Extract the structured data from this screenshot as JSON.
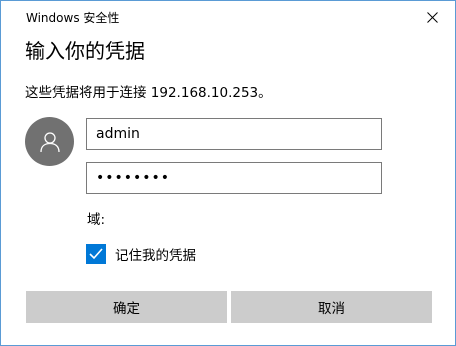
{
  "window": {
    "title": "Windows 安全性",
    "close_icon": "close-icon"
  },
  "dialog": {
    "heading": "输入你的凭据",
    "description": "这些凭据将用于连接 192.168.10.253。"
  },
  "credentials": {
    "avatar_icon": "user-icon",
    "username_value": "admin",
    "password_value": "********",
    "domain_label": "域:"
  },
  "remember": {
    "label": "记住我的凭据",
    "checked": true,
    "check_color": "#0078d7"
  },
  "buttons": {
    "ok_label": "确定",
    "cancel_label": "取消"
  }
}
